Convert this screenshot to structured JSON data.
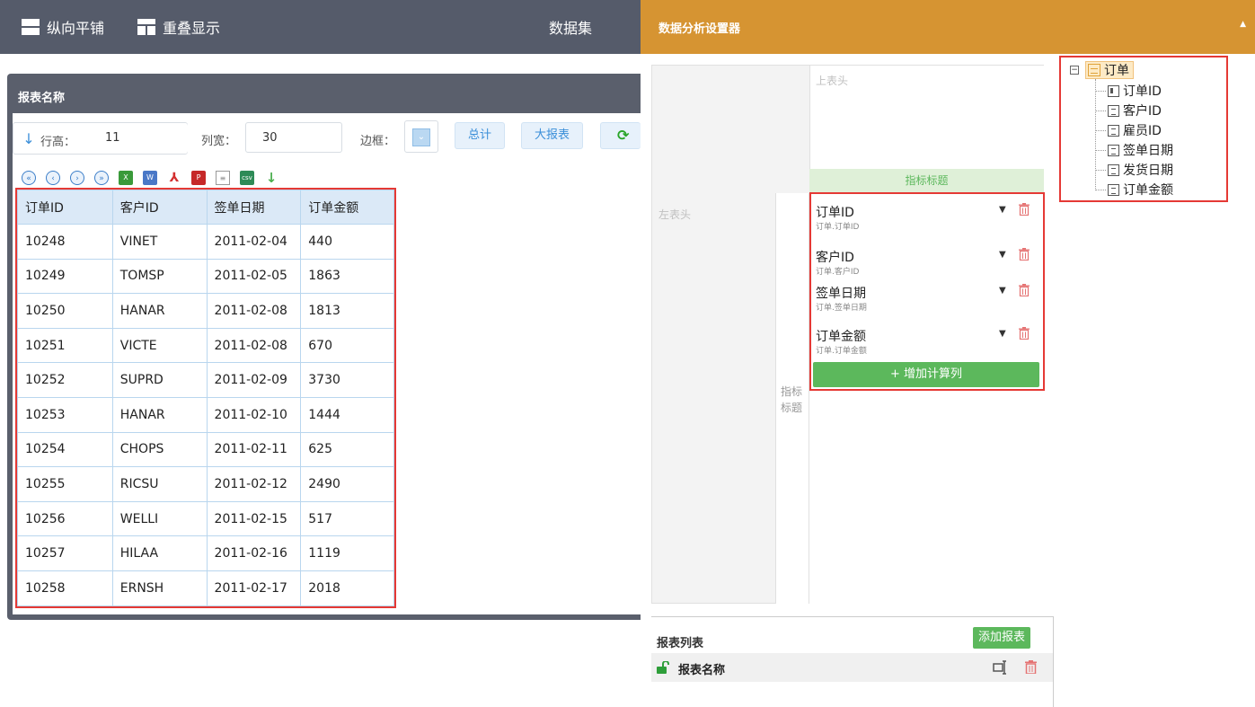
{
  "topbar": {
    "vertical_tile": "纵向平铺",
    "overlap_display": "重叠显示",
    "dataset": "数据集"
  },
  "report": {
    "title": "报表名称",
    "row_height_label": "行高：",
    "row_height_value": "11",
    "col_width_label": "列宽：",
    "col_width_value": "30",
    "border_label": "边框：",
    "total_button": "总计",
    "big_report_button": "大报表",
    "table": {
      "headers": [
        "订单ID",
        "客户ID",
        "签单日期",
        "订单金额"
      ],
      "rows": [
        [
          "10248",
          "VINET",
          "2011-02-04",
          "440"
        ],
        [
          "10249",
          "TOMSP",
          "2011-02-05",
          "1863"
        ],
        [
          "10250",
          "HANAR",
          "2011-02-08",
          "1813"
        ],
        [
          "10251",
          "VICTE",
          "2011-02-08",
          "670"
        ],
        [
          "10252",
          "SUPRD",
          "2011-02-09",
          "3730"
        ],
        [
          "10253",
          "HANAR",
          "2011-02-10",
          "1444"
        ],
        [
          "10254",
          "CHOPS",
          "2011-02-11",
          "625"
        ],
        [
          "10255",
          "RICSU",
          "2011-02-12",
          "2490"
        ],
        [
          "10256",
          "WELLI",
          "2011-02-15",
          "517"
        ],
        [
          "10257",
          "HILAA",
          "2011-02-16",
          "1119"
        ],
        [
          "10258",
          "ERNSH",
          "2011-02-17",
          "2018"
        ]
      ]
    }
  },
  "designer": {
    "title": "数据分析设置器",
    "top_header": "上表头",
    "metric_title_bar": "指标标题",
    "left_header": "左表头",
    "metric_title_vertical": "指标标题",
    "fields": [
      {
        "name": "订单ID",
        "path": "订单.订单ID"
      },
      {
        "name": "客户ID",
        "path": "订单.客户ID"
      },
      {
        "name": "签单日期",
        "path": "订单.签单日期"
      },
      {
        "name": "订单金额",
        "path": "订单.订单金额"
      }
    ],
    "add_calc_column": "+ 增加计算列"
  },
  "report_list": {
    "title": "报表列表",
    "add_button": "添加报表",
    "items": [
      {
        "name": "报表名称"
      }
    ]
  },
  "tree": {
    "root": "订单",
    "children": [
      "订单ID",
      "客户ID",
      "雇员ID",
      "签单日期",
      "发货日期",
      "订单金额"
    ]
  },
  "colors": {
    "topbar": "#555b6a",
    "right_header": "#d69432",
    "highlight_border": "#e53935",
    "green": "#5cb85c",
    "blue_accent": "#3b8fd9"
  }
}
